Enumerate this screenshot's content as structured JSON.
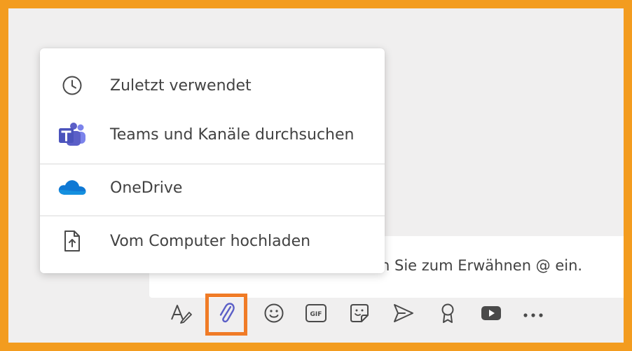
{
  "attach_menu": {
    "items": [
      {
        "label": "Zuletzt verwendet",
        "icon": "clock-icon"
      },
      {
        "label": "Teams und Kanäle durchsuchen",
        "icon": "teams-icon"
      },
      {
        "label": "OneDrive",
        "icon": "onedrive-cloud-icon"
      },
      {
        "label": "Vom Computer hochladen",
        "icon": "upload-file-icon"
      }
    ]
  },
  "compose": {
    "placeholder_visible": "n Sie zum Erwähnen @ ein."
  },
  "toolbar": {
    "buttons": [
      {
        "name": "format",
        "icon": "format-text-icon"
      },
      {
        "name": "attach",
        "icon": "paperclip-icon",
        "highlighted": true
      },
      {
        "name": "emoji",
        "icon": "emoji-icon"
      },
      {
        "name": "gif",
        "icon": "gif-icon",
        "text": "GIF"
      },
      {
        "name": "sticker",
        "icon": "sticker-icon"
      },
      {
        "name": "send",
        "icon": "send-icon"
      },
      {
        "name": "praise",
        "icon": "praise-icon"
      },
      {
        "name": "stream",
        "icon": "video-icon"
      },
      {
        "name": "more",
        "icon": "more-options-icon"
      }
    ]
  },
  "colors": {
    "frame": "#f39c1f",
    "highlight": "#f07b26",
    "teams_purple": "#5b5fc7",
    "onedrive_blue": "#0f78d4",
    "icon_gray": "#4a4a4a"
  }
}
